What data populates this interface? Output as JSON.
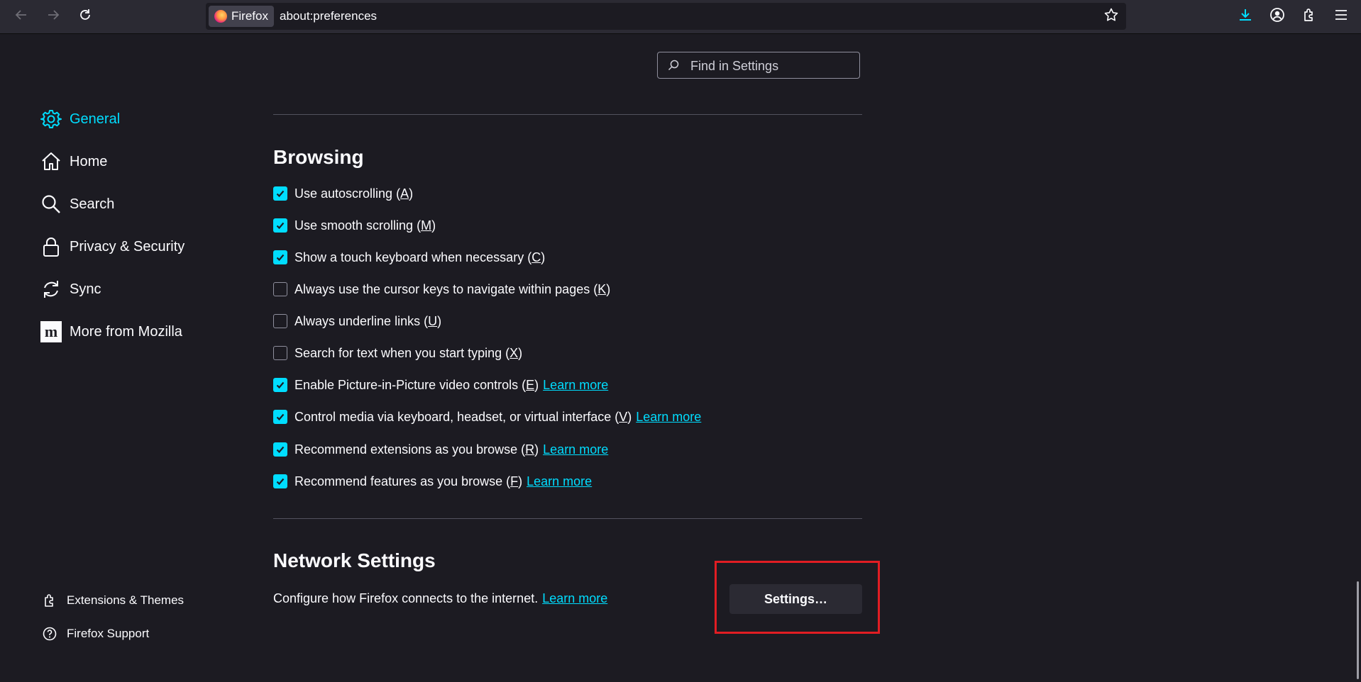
{
  "browser": {
    "identity_label": "Firefox",
    "url": "about:preferences"
  },
  "search": {
    "placeholder": "Find in Settings"
  },
  "sidebar": {
    "items": [
      {
        "label": "General",
        "icon": "gear-icon",
        "selected": true
      },
      {
        "label": "Home",
        "icon": "home-icon"
      },
      {
        "label": "Search",
        "icon": "search-icon"
      },
      {
        "label": "Privacy & Security",
        "icon": "lock-icon"
      },
      {
        "label": "Sync",
        "icon": "sync-icon"
      },
      {
        "label": "More from Mozilla",
        "icon": "mozilla-icon"
      }
    ],
    "footer": [
      {
        "label": "Extensions & Themes",
        "icon": "puzzle-icon"
      },
      {
        "label": "Firefox Support",
        "icon": "help-icon"
      }
    ]
  },
  "browsing": {
    "title": "Browsing",
    "options": [
      {
        "label": "Use autoscrolling (",
        "key": "A",
        "end": ")",
        "checked": true,
        "link": ""
      },
      {
        "label": "Use smooth scrolling (",
        "key": "M",
        "end": ")",
        "checked": true,
        "link": ""
      },
      {
        "label": "Show a touch keyboard when necessary (",
        "key": "C",
        "end": ")",
        "checked": true,
        "link": ""
      },
      {
        "label": "Always use the cursor keys to navigate within pages (",
        "key": "K",
        "end": ")",
        "checked": false,
        "link": ""
      },
      {
        "label": "Always underline links (",
        "key": "U",
        "end": ")",
        "checked": false,
        "link": ""
      },
      {
        "label": "Search for text when you start typing (",
        "key": "X",
        "end": ")",
        "checked": false,
        "link": ""
      },
      {
        "label": "Enable Picture-in-Picture video controls (",
        "key": "E",
        "end": ")",
        "checked": true,
        "link": "Learn more"
      },
      {
        "label": "Control media via keyboard, headset, or virtual interface (",
        "key": "V",
        "end": ")",
        "checked": true,
        "link": "Learn more"
      },
      {
        "label": "Recommend extensions as you browse (",
        "key": "R",
        "end": ")",
        "checked": true,
        "link": "Learn more"
      },
      {
        "label": "Recommend features as you browse (",
        "key": "F",
        "end": ")",
        "checked": true,
        "link": "Learn more"
      }
    ]
  },
  "network": {
    "title": "Network Settings",
    "description": "Configure how Firefox connects to the internet.",
    "link": "Learn more",
    "button": "Settings…"
  },
  "colors": {
    "accent": "#00ddff",
    "background": "#1c1b22",
    "highlight": "#e11d23"
  }
}
